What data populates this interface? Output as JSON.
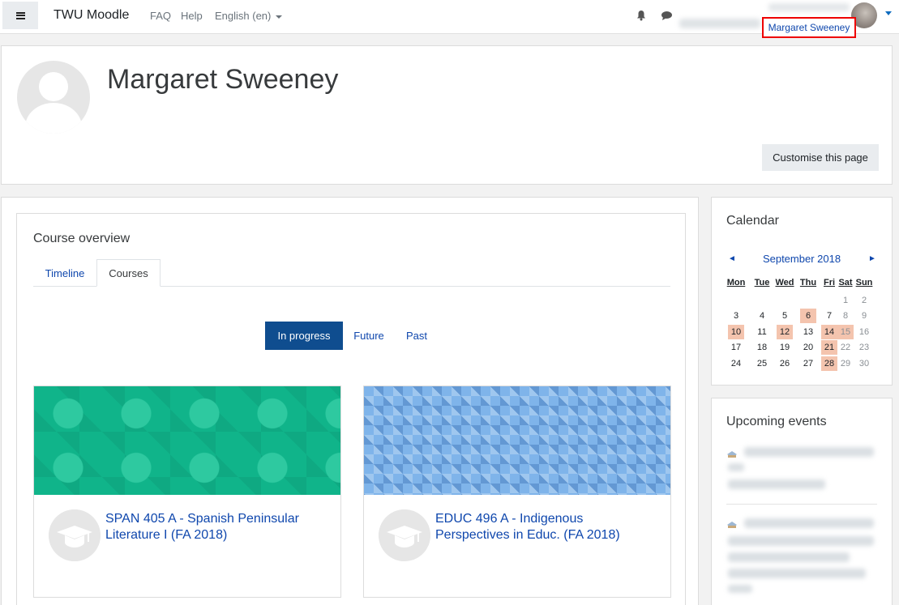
{
  "navbar": {
    "brand": "TWU Moodle",
    "links": {
      "faq": "FAQ",
      "help": "Help",
      "language": "English (en)"
    },
    "user_name": "Margaret Sweeney"
  },
  "profile": {
    "name": "Margaret Sweeney",
    "customise_button": "Customise this page"
  },
  "course_overview": {
    "title": "Course overview",
    "tabs": {
      "timeline": "Timeline",
      "courses": "Courses"
    },
    "filters": {
      "in_progress": "In progress",
      "future": "Future",
      "past": "Past"
    },
    "courses": [
      {
        "title": "SPAN 405 A - Spanish Peninsular Literature I (FA 2018)"
      },
      {
        "title": "EDUC 496 A - Indigenous Perspectives in Educ. (FA 2018)"
      }
    ]
  },
  "calendar": {
    "title": "Calendar",
    "month": "September 2018",
    "prev": "◄",
    "next": "►",
    "weekdays": [
      "Mon",
      "Tue",
      "Wed",
      "Thu",
      "Fri",
      "Sat",
      "Sun"
    ],
    "days": [
      "1",
      "2",
      "3",
      "4",
      "5",
      "6",
      "7",
      "8",
      "9",
      "10",
      "11",
      "12",
      "13",
      "14",
      "15",
      "16",
      "17",
      "18",
      "19",
      "20",
      "21",
      "22",
      "23",
      "24",
      "25",
      "26",
      "27",
      "28",
      "29",
      "30"
    ],
    "event_days": [
      6,
      10,
      12,
      14,
      15,
      21,
      28
    ]
  },
  "upcoming_events": {
    "title": "Upcoming events"
  },
  "colors": {
    "link": "#0f47ad",
    "active_filter": "#0f4d8f",
    "event_day": "#f4c4ae",
    "highlight_box": "#e00000"
  }
}
